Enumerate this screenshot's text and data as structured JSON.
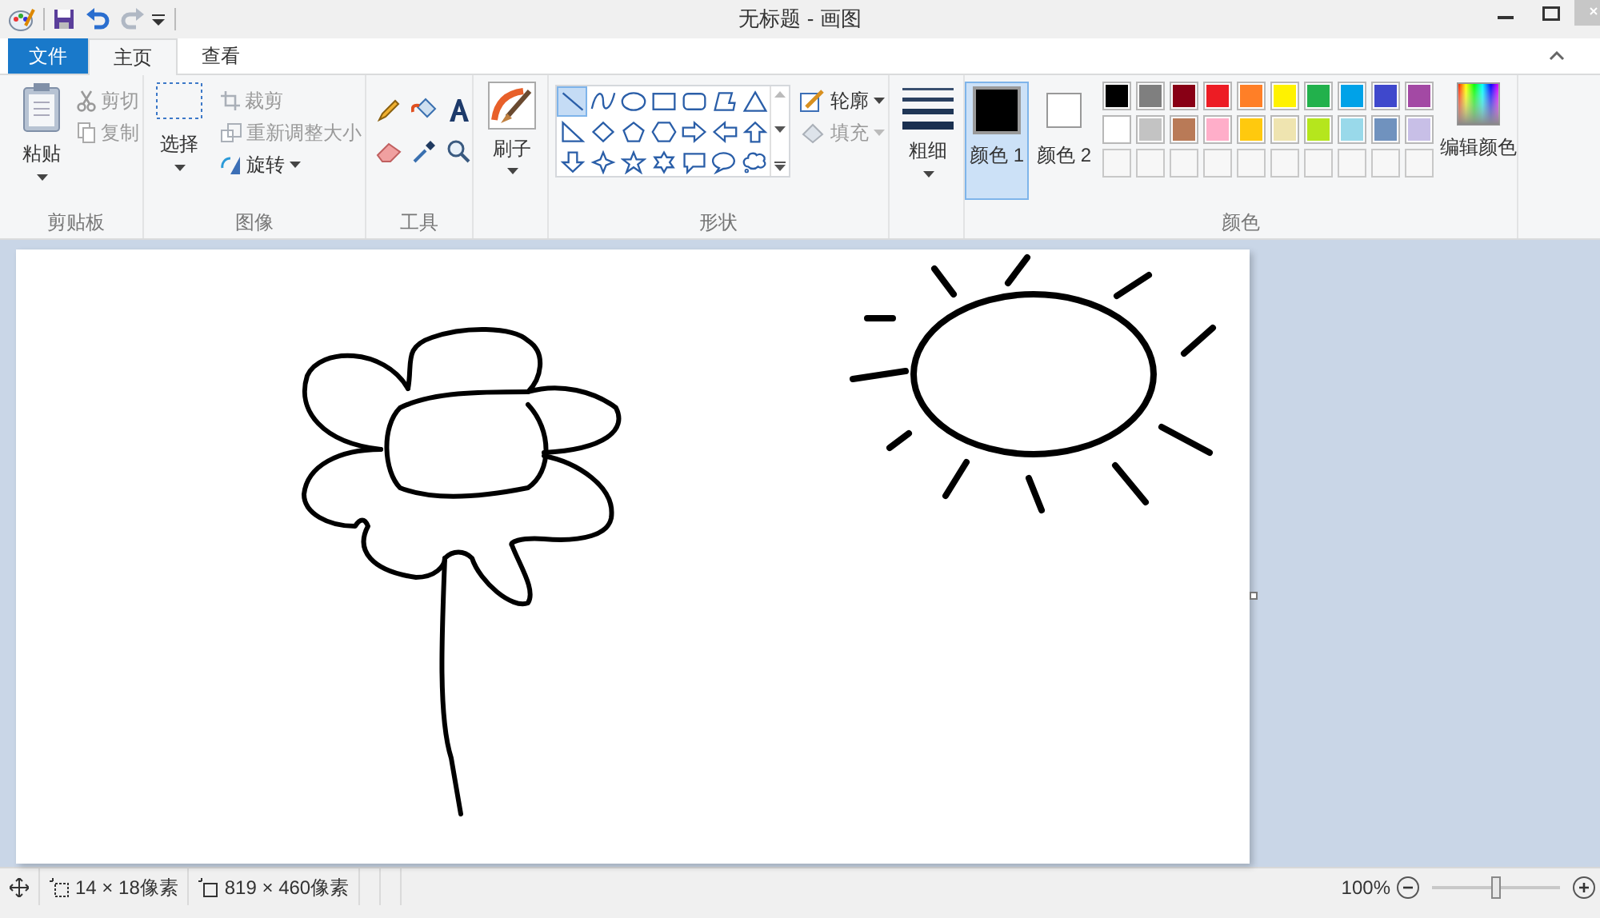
{
  "window": {
    "title": "无标题 - 画图"
  },
  "tabs": [
    {
      "label": "文件",
      "kind": "file",
      "selected": false
    },
    {
      "label": "主页",
      "kind": "tab",
      "selected": true
    },
    {
      "label": "查看",
      "kind": "tab",
      "selected": false
    }
  ],
  "clipboard": {
    "paste": "粘贴",
    "cut": {
      "label": "剪切",
      "disabled": true
    },
    "copy": {
      "label": "复制",
      "disabled": true
    },
    "group": "剪贴板"
  },
  "image": {
    "select": "选择",
    "crop": {
      "label": "裁剪",
      "disabled": true
    },
    "resize": {
      "label": "重新调整大小",
      "disabled": true
    },
    "rotate": {
      "label": "旋转",
      "disabled": false
    },
    "group": "图像"
  },
  "tools": {
    "group": "工具"
  },
  "brushes": {
    "label": "刷子"
  },
  "shapes": {
    "group": "形状",
    "items": [
      {
        "kind": "line",
        "selected": true
      },
      {
        "kind": "curve",
        "selected": false
      },
      {
        "kind": "oval",
        "selected": false
      },
      {
        "kind": "rect",
        "selected": false
      },
      {
        "kind": "roundrect",
        "selected": false
      },
      {
        "kind": "polygon",
        "selected": false
      },
      {
        "kind": "triangle",
        "selected": false
      },
      {
        "kind": "righttriangle",
        "selected": false
      },
      {
        "kind": "diamond",
        "selected": false
      },
      {
        "kind": "pentagon",
        "selected": false
      },
      {
        "kind": "hexagon",
        "selected": false
      },
      {
        "kind": "rightarrow",
        "selected": false
      },
      {
        "kind": "leftarrow",
        "selected": false
      },
      {
        "kind": "uparrow",
        "selected": false
      },
      {
        "kind": "downarrow",
        "selected": false
      },
      {
        "kind": "star4",
        "selected": false
      },
      {
        "kind": "star5",
        "selected": false
      },
      {
        "kind": "star6",
        "selected": false
      },
      {
        "kind": "rectcallout",
        "selected": false
      },
      {
        "kind": "ovalcallout",
        "selected": false
      },
      {
        "kind": "cloudcallout",
        "selected": false
      }
    ],
    "outline": {
      "label": "轮廓",
      "disabled": false
    },
    "fill": {
      "label": "填充",
      "disabled": true
    }
  },
  "size": {
    "label": "粗细"
  },
  "colors": {
    "group": "颜色",
    "slots": [
      {
        "label": "颜色 1",
        "color": "#000000",
        "selected": true
      },
      {
        "label": "颜色 2",
        "color": "#ffffff",
        "selected": false
      }
    ],
    "palette": [
      {
        "color": "#000000"
      },
      {
        "color": "#7f7f7f"
      },
      {
        "color": "#880015"
      },
      {
        "color": "#ed1c24"
      },
      {
        "color": "#ff7f27"
      },
      {
        "color": "#fff200"
      },
      {
        "color": "#22b14c"
      },
      {
        "color": "#00a2e8"
      },
      {
        "color": "#3f48cc"
      },
      {
        "color": "#a349a4"
      },
      {
        "color": "#ffffff"
      },
      {
        "color": "#c3c3c3"
      },
      {
        "color": "#b97a57"
      },
      {
        "color": "#ffaec9"
      },
      {
        "color": "#ffc90e"
      },
      {
        "color": "#efe4b0"
      },
      {
        "color": "#b5e61d"
      },
      {
        "color": "#99d9ea"
      },
      {
        "color": "#7092be"
      },
      {
        "color": "#c8bfe7"
      }
    ],
    "edit": "编辑颜色"
  },
  "status_bar": {
    "selection_size": "14 × 18像素",
    "image_size": "819 × 460像素",
    "zoom": "100%",
    "zoom_slider": {
      "level": 0.5
    }
  }
}
